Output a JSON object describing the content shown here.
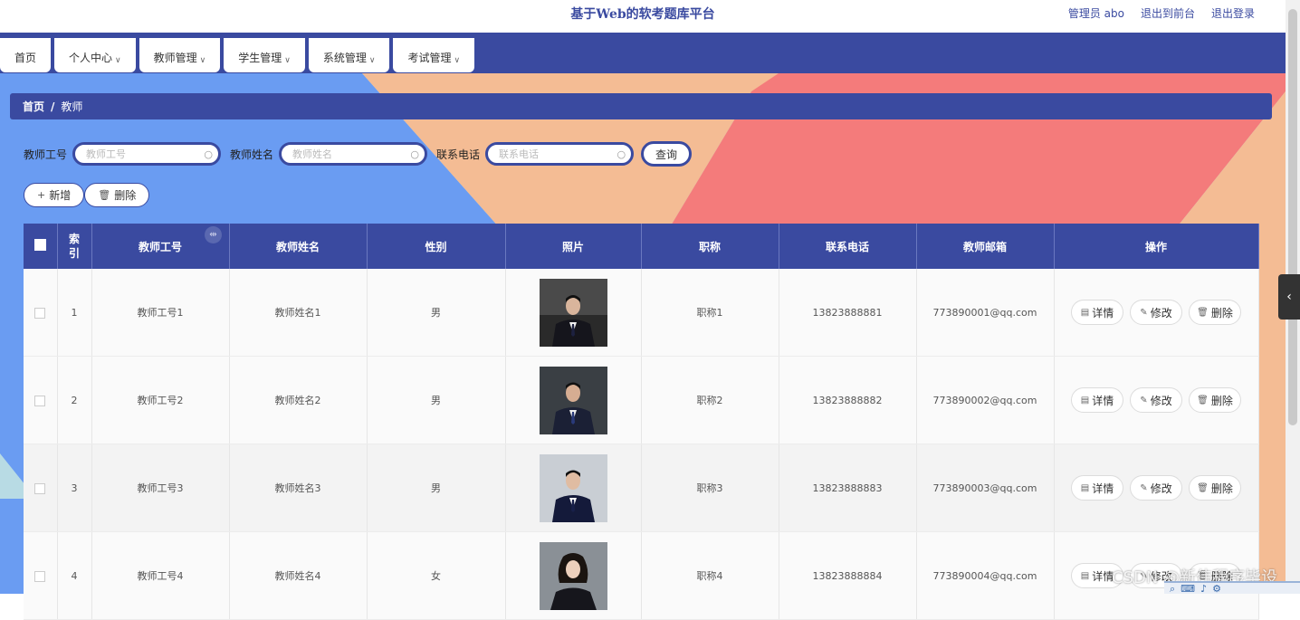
{
  "header": {
    "title": "基于Web的软考题库平台",
    "user": "管理员 abo",
    "exit_front": "退出到前台",
    "logout": "退出登录"
  },
  "nav": {
    "items": [
      {
        "label": "首页",
        "dropdown": false
      },
      {
        "label": "个人中心",
        "dropdown": true
      },
      {
        "label": "教师管理",
        "dropdown": true
      },
      {
        "label": "学生管理",
        "dropdown": true
      },
      {
        "label": "系统管理",
        "dropdown": true
      },
      {
        "label": "考试管理",
        "dropdown": true
      }
    ]
  },
  "breadcrumb": {
    "home": "首页",
    "separator": "/",
    "current": "教师"
  },
  "search": {
    "field1_label": "教师工号",
    "field1_placeholder": "教师工号",
    "field2_label": "教师姓名",
    "field2_placeholder": "教师姓名",
    "field3_label": "联系电话",
    "field3_placeholder": "联系电话",
    "query_label": "查询"
  },
  "actions": {
    "add_label": "新增",
    "delete_label": "删除"
  },
  "table": {
    "headers": [
      "索引",
      "教师工号",
      "教师姓名",
      "性别",
      "照片",
      "职称",
      "联系电话",
      "教师邮箱",
      "操作"
    ],
    "rows": [
      {
        "index": "1",
        "id": "教师工号1",
        "name": "教师姓名1",
        "gender": "男",
        "title": "职称1",
        "phone": "13823888881",
        "email": "773890001@qq.com"
      },
      {
        "index": "2",
        "id": "教师工号2",
        "name": "教师姓名2",
        "gender": "男",
        "title": "职称2",
        "phone": "13823888882",
        "email": "773890002@qq.com"
      },
      {
        "index": "3",
        "id": "教师工号3",
        "name": "教师姓名3",
        "gender": "男",
        "title": "职称3",
        "phone": "13823888883",
        "email": "773890003@qq.com"
      },
      {
        "index": "4",
        "id": "教师工号4",
        "name": "教师姓名4",
        "gender": "女",
        "title": "职称4",
        "phone": "13823888884",
        "email": "773890004@qq.com"
      }
    ],
    "op_detail": "详情",
    "op_edit": "修改",
    "op_delete": "删除"
  },
  "watermark": "CSDN @新伟程序毕设",
  "colors": {
    "primary": "#3a4aa0",
    "blue_bg": "#6a9cf2",
    "peach_bg": "#f4bc94",
    "coral_bg": "#f47b7b"
  }
}
